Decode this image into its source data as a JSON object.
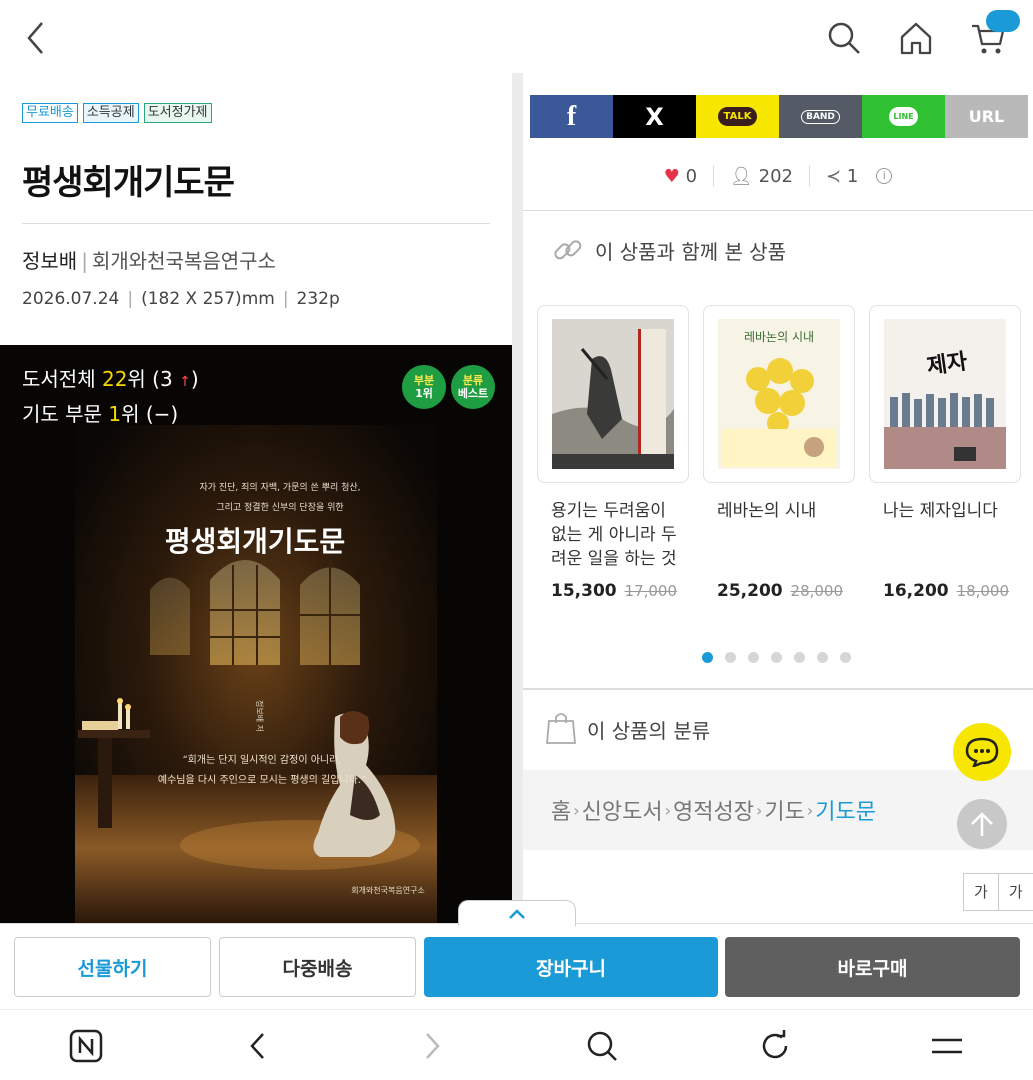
{
  "topbar": {
    "icons": [
      "back-icon",
      "search-icon",
      "home-icon",
      "cart-icon"
    ]
  },
  "product": {
    "badges": [
      "무료배송",
      "소득공제",
      "도서정가제"
    ],
    "title": "평생회개기도문",
    "author": "정보배",
    "publisher": "회개와천국복음연구소",
    "date": "2026.07.24",
    "size": "(182 X 257)mm",
    "pages": "232p"
  },
  "ranking": {
    "overall_prefix": "도서전체 ",
    "overall_rank": "22",
    "overall_suffix": "위 (3 ",
    "overall_change": "↑",
    "overall_close": ")",
    "category_prefix": "기도 부문 ",
    "category_rank": "1",
    "category_suffix": "위 (−)",
    "badge1_top": "부분",
    "badge1_bottom": "1위",
    "badge2_top": "분류",
    "badge2_bottom": "베스트"
  },
  "cover": {
    "line1": "자가 진단, 죄의 자백, 가문의 쓴 뿌리 청산,",
    "line2": "그리고 정결한 신부의 단장을 위한",
    "title": "평생회개기도문",
    "author_vertical": "정보배 저",
    "quote1": "“회개는 단지 일시적인 감정이 아니라,",
    "quote2": "예수님을 다시 주인으로 모시는 평생의 길입니다.”",
    "publisher": "회개와천국복음연구소"
  },
  "share": {
    "buttons": [
      "f",
      "X",
      "TALK",
      "BAND",
      "LINE",
      "URL"
    ]
  },
  "stats": {
    "likes": "0",
    "views": "202",
    "shares": "1"
  },
  "related": {
    "title": "이 상품과 함께 본 상품",
    "items": [
      {
        "name": "용기는 두려움이 없는 게 아니라 두려운 일을 하는 것",
        "price": "15,300",
        "original": "17,000"
      },
      {
        "name": "레바논의 시내",
        "price": "25,200",
        "original": "28,000"
      },
      {
        "name": "나는 제자입니다",
        "price": "16,200",
        "original": "18,000"
      }
    ]
  },
  "category": {
    "title": "이 상품의 분류",
    "crumbs": [
      "홈",
      "신앙도서",
      "영적성장",
      "기도"
    ],
    "current": "기도문"
  },
  "font_control": {
    "minus": "가 −",
    "plus": "가"
  },
  "actions": {
    "gift": "선물하기",
    "multi": "다중배송",
    "cart": "장바구니",
    "buy": "바로구매"
  },
  "colors": {
    "accent": "#1a9ad6",
    "buy": "#5f5f5f",
    "kakao": "#f7e600"
  }
}
